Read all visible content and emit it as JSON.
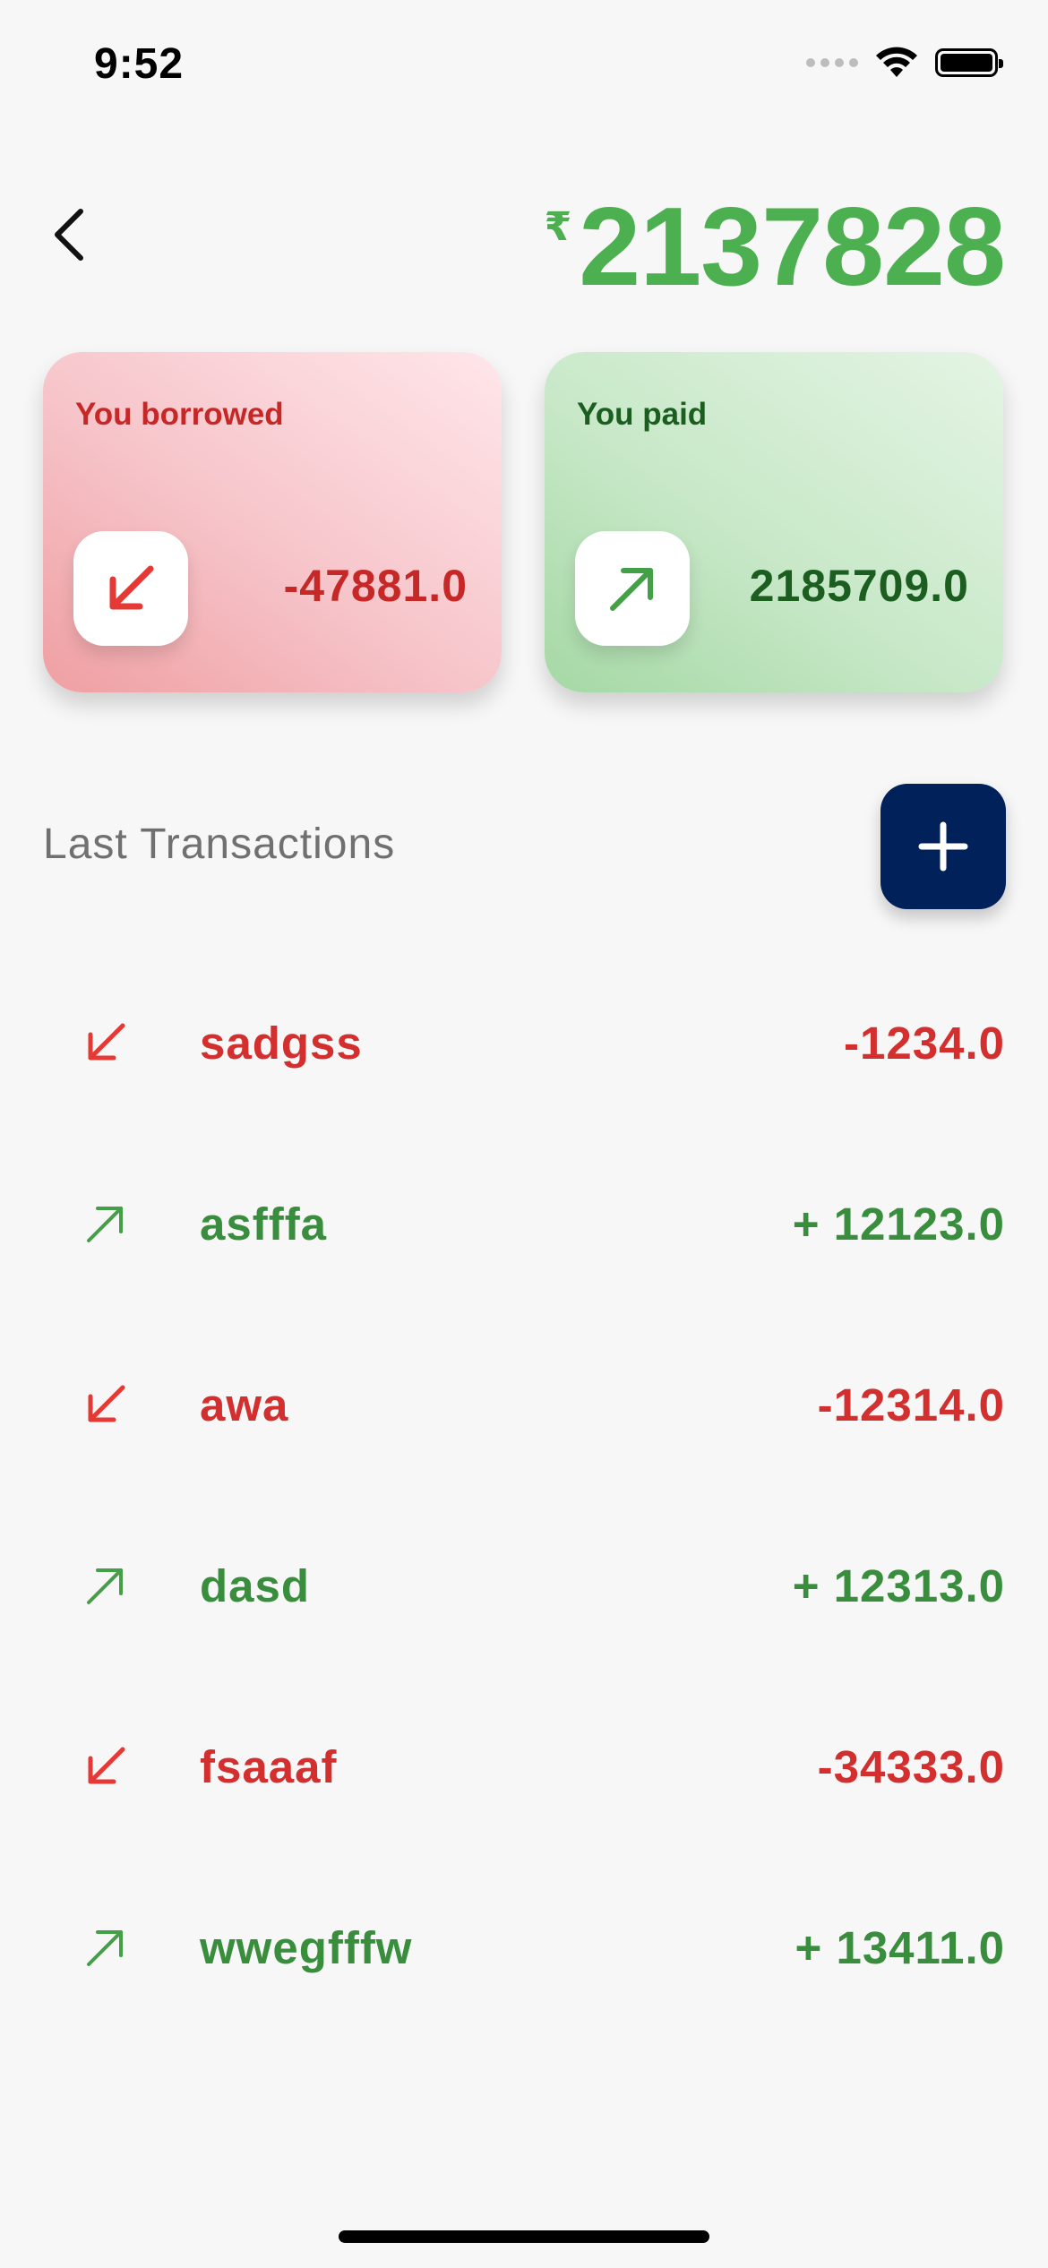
{
  "status_bar": {
    "time": "9:52"
  },
  "header": {
    "currency_symbol": "₹",
    "balance": "2137828"
  },
  "cards": {
    "borrowed": {
      "label": "You borrowed",
      "value": "-47881.0"
    },
    "paid": {
      "label": "You paid",
      "value": "2185709.0"
    }
  },
  "section": {
    "title": "Last Transactions"
  },
  "transactions": [
    {
      "name": "sadgss",
      "amount": "-1234.0",
      "direction": "borrowed"
    },
    {
      "name": "asfffa",
      "amount": "+ 12123.0",
      "direction": "paid"
    },
    {
      "name": "awa",
      "amount": "-12314.0",
      "direction": "borrowed"
    },
    {
      "name": "dasd",
      "amount": "+ 12313.0",
      "direction": "paid"
    },
    {
      "name": "fsaaaf",
      "amount": "-34333.0",
      "direction": "borrowed"
    },
    {
      "name": "wwegfffw",
      "amount": "+ 13411.0",
      "direction": "paid"
    }
  ],
  "colors": {
    "positive": "#388e3c",
    "negative": "#d32f2f",
    "balance": "#4caf50",
    "add_button": "#00215a"
  },
  "icons": {
    "back": "chevron-left-icon",
    "borrowed": "arrow-down-left-icon",
    "paid": "arrow-up-right-icon",
    "add": "plus-icon"
  }
}
